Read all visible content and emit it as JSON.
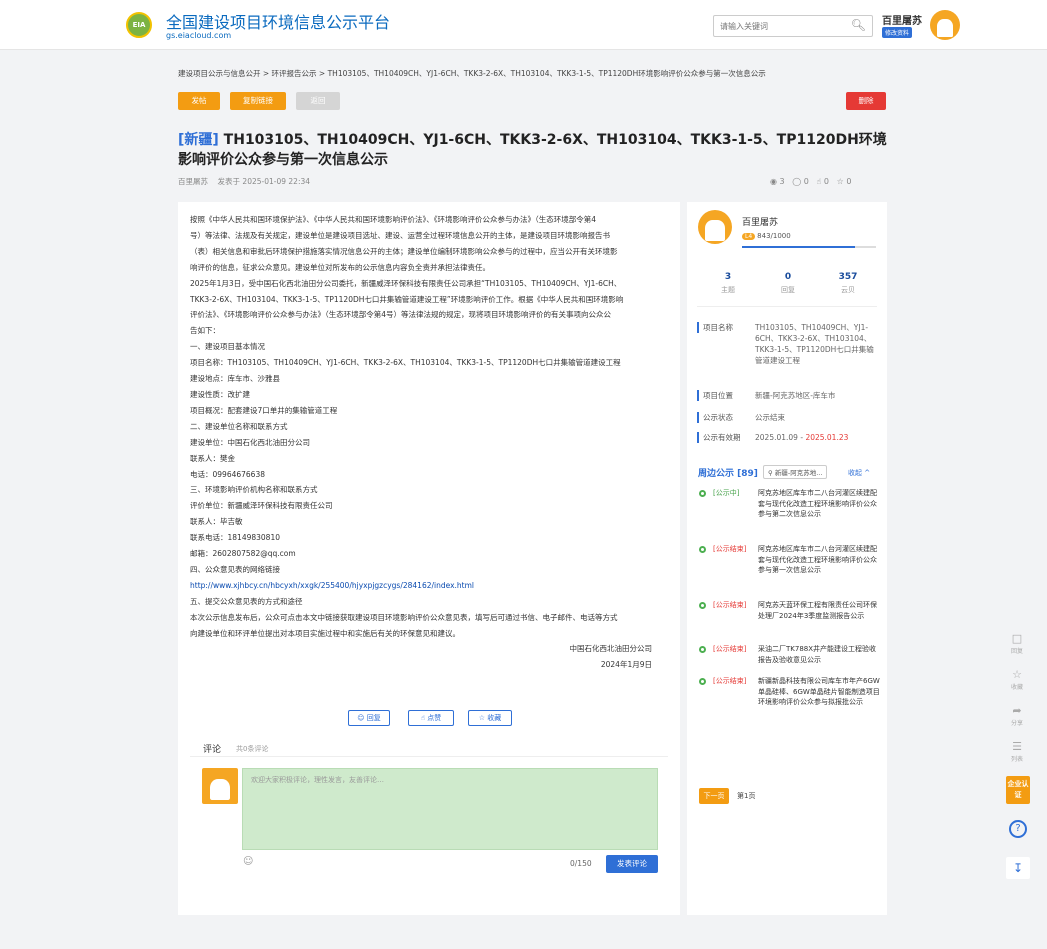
{
  "header": {
    "logo_text": "EIA",
    "site_name": "全国建设项目环境信息公示平台",
    "site_url": "gs.eiacloud.com",
    "search_placeholder": "请输入关键词",
    "user_name": "百里屠苏",
    "edit_profile": "修改资料"
  },
  "breadcrumb": "建设项目公示与信息公开 > 环评报告公示 > TH103105、TH10409CH、YJ1-6CH、TKK3-2-6X、TH103104、TKK3-1-5、TP1120DH环境影响评价公众参与第一次信息公示",
  "toolbar": {
    "publish": "发帖",
    "copy_link": "复制链接",
    "back": "返回",
    "delete": "删除"
  },
  "article": {
    "tag": "[新疆]",
    "title": "TH103105、TH10409CH、YJ1-6CH、TKK3-2-6X、TH103104、TKK3-1-5、TP1120DH环境影响评价公众参与第一次信息公示",
    "author": "百里屠苏",
    "published": "发表于 2025-01-09 22:34",
    "views": "3",
    "comments": "0",
    "likes": "0",
    "favorites": "0",
    "lines": [
      "按照《中华人民共和国环境保护法》、《中华人民共和国环境影响评价法》、《环境影响评价公众参与办法》（生态环境部令第4",
      "号）等法律、法规及有关规定，建设单位是建设项目选址、建设、运营全过程环境信息公开的主体，是建设项目环境影响报告书",
      "（表）相关信息和审批后环境保护措施落实情况信息公开的主体；建设单位编制环境影响公众参与的过程中，应当公开有关环境影",
      "响评价的信息，征求公众意见。建设单位对所发布的公示信息内容负全责并承担法律责任。",
      "2025年1月3日，受中国石化西北油田分公司委托，新疆威泽环保科技有限责任公司承担“TH103105、TH10409CH、YJ1-6CH、",
      "TKK3-2-6X、TH103104、TKK3-1-5、TP1120DH七口井集输管道建设工程”环境影响评价工作。根据《中华人民共和国环境影响",
      "评价法》、《环境影响评价公众参与办法》（生态环境部令第4号）等法律法规的规定，现将项目环境影响评价的有关事项向公众公",
      "告如下：",
      "一、建设项目基本情况",
      "项目名称：TH103105、TH10409CH、YJ1-6CH、TKK3-2-6X、TH103104、TKK3-1-5、TP1120DH七口井集输管道建设工程",
      "建设地点：库车市、沙雅县",
      "建设性质：改扩建",
      "项目概况：配套建设7口单井的集输管道工程",
      "二、建设单位名称和联系方式",
      "建设单位：中国石化西北油田分公司",
      "联系人：樊金",
      "电话：09964676638",
      "三、环境影响评价机构名称和联系方式",
      "评价单位：新疆威泽环保科技有限责任公司",
      "联系人：毕吉敏",
      "联系电话：18149830810",
      "邮箱：2602807582@qq.com",
      "四、公众意见表的网络链接"
    ],
    "link": "http://www.xjhbcy.cn/hbcyxh/xxgk/255400/hjyxpjgzcygs/284162/index.html",
    "lines2": [
      "五、提交公众意见表的方式和途径",
      "本次公示信息发布后，公众可点击本文中链接获取建设项目环境影响评价公众意见表，填写后可通过书信、电子邮件、电话等方式",
      "向建设单位和环评单位提出对本项目实施过程中和实施后有关的环保意见和建议。"
    ],
    "sign_org": "中国石化西北油田分公司",
    "sign_date": "2024年1月9日"
  },
  "actions": {
    "reply": "回复",
    "like": "点赞",
    "favorite": "收藏"
  },
  "comments": {
    "title": "评论",
    "count": "共0条评论",
    "placeholder": "欢迎大家积极评论，理性发言，友善评论…",
    "char_count": "0/150",
    "submit": "发表评论"
  },
  "sidebar": {
    "user_name": "百里屠苏",
    "level_badge": "L4",
    "level_points": "843/1000",
    "level_progress": 0.843,
    "stats": [
      {
        "num": "3",
        "label": "主题"
      },
      {
        "num": "0",
        "label": "回复"
      },
      {
        "num": "357",
        "label": "云贝"
      }
    ],
    "info": {
      "name_k": "项目名称",
      "name_v": "TH103105、TH10409CH、YJ1-6CH、TKK3-2-6X、TH103104、TKK3-1-5、TP1120DH七口井集输管道建设工程",
      "loc_k": "项目位置",
      "loc_v": "新疆-阿克苏地区-库车市",
      "status_k": "公示状态",
      "status_v": "公示结束",
      "period_k": "公示有效期",
      "period_start": "2025.01.09 -",
      "period_end": "2025.01.23"
    },
    "nearby": {
      "title": "周边公示 [89]",
      "location": "新疆-阿克苏地...",
      "collapse": "收起 ^",
      "items": [
        {
          "status": "[公示中]",
          "text": "阿克苏地区库车市二八台河灌区续建配套与现代化改造工程环境影响评价公众参与第二次信息公示"
        },
        {
          "status": "[公示结束]",
          "text": "阿克苏地区库车市二八台河灌区续建配套与现代化改造工程环境影响评价公众参与第一次信息公示"
        },
        {
          "status": "[公示结束]",
          "text": "阿克苏天蓝环保工程有限责任公司环保处理厂2024年3季度监测报告公示"
        },
        {
          "status": "[公示结束]",
          "text": "采油二厂TK788X井产能建设工程验收报告及验收意见公示"
        },
        {
          "status": "[公示结束]",
          "text": "新疆新晶科技有限公司库车市年产6GW单晶硅棒、6GW单晶硅片智能制造项目环境影响评价公众参与拟报批公示"
        }
      ],
      "next": "下一页",
      "page": "第1页"
    }
  },
  "floatbar": {
    "reply": "回复",
    "favorite": "收藏",
    "share": "分享",
    "list": "列表",
    "enterprise": "企业认证"
  }
}
